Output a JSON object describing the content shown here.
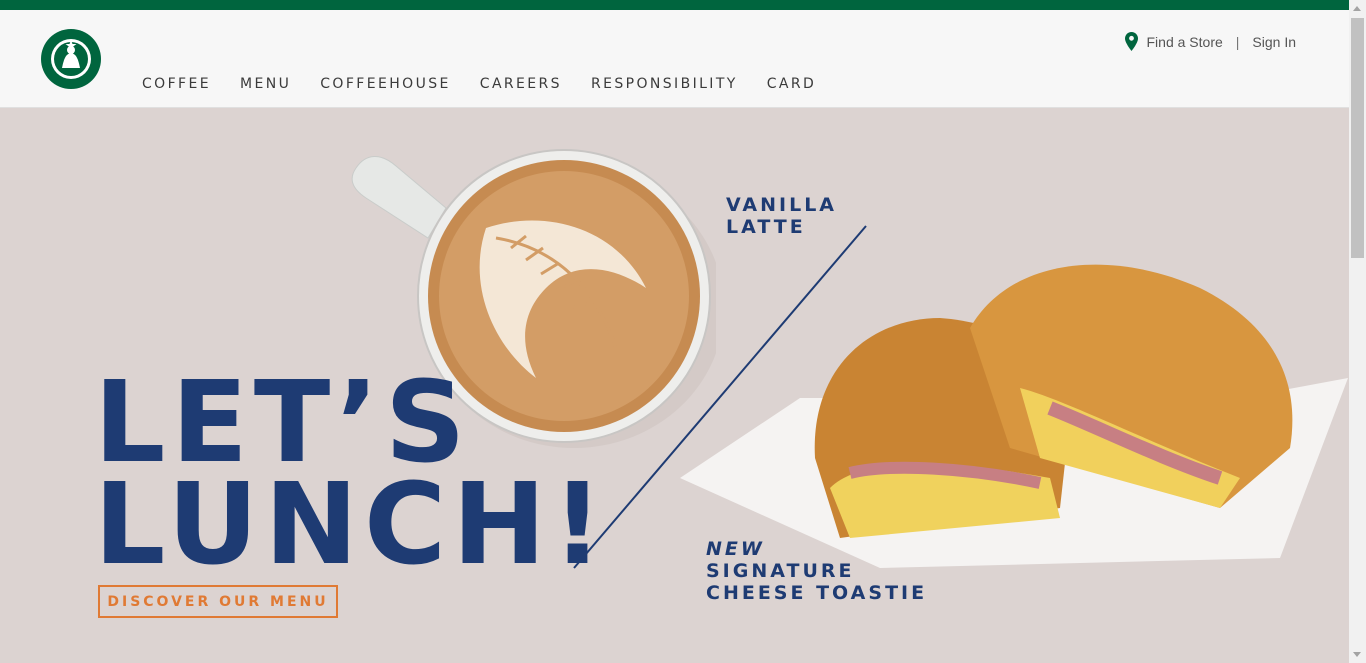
{
  "brand": {
    "colors": {
      "green": "#00653e",
      "navy": "#1e3b73",
      "orange": "#e07a34",
      "hero_bg": "#dcd3d1"
    }
  },
  "header": {
    "nav": [
      "COFFEE",
      "MENU",
      "COFFEEHOUSE",
      "CAREERS",
      "RESPONSIBILITY",
      "CARD"
    ],
    "utility": {
      "find_store": "Find a Store",
      "sign_in": "Sign In",
      "separator": "|"
    }
  },
  "hero": {
    "headline_line1": "LET’S",
    "headline_line2": "LUNCH!",
    "cta": "DISCOVER OUR MENU",
    "latte_line1": "VANILLA",
    "latte_line2": "LATTE",
    "toastie_new": "NEW",
    "toastie_line1": "SIGNATURE",
    "toastie_line2": "CHEESE TOASTIE"
  },
  "icons": {
    "location": "location-pin-icon",
    "logo": "siren-logo-icon"
  }
}
